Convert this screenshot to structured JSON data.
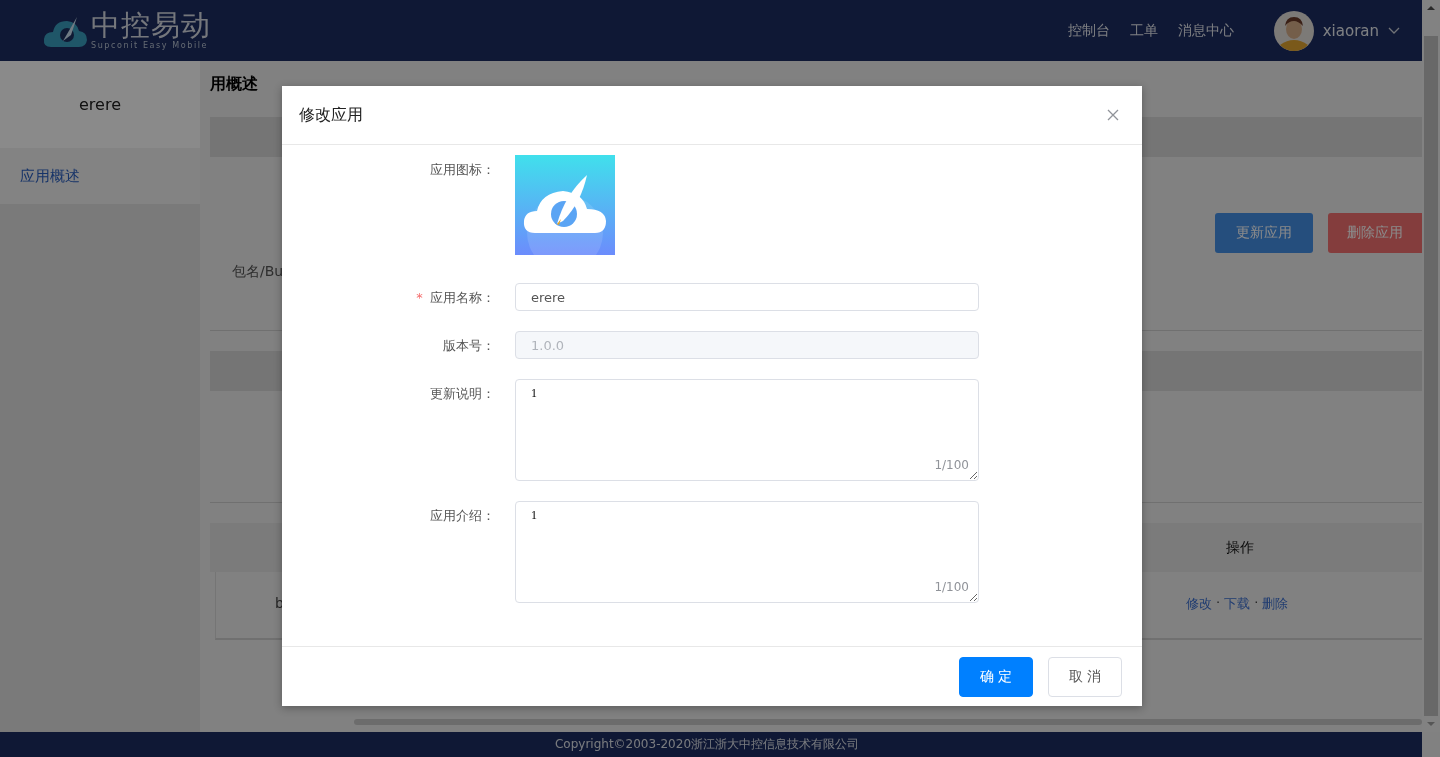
{
  "header": {
    "logo_title": "中控易动",
    "logo_subtitle": "Supconit Easy Mobile",
    "nav": [
      "控制台",
      "工单",
      "消息中心"
    ],
    "user": {
      "name": "xiaoran"
    }
  },
  "sidebar": {
    "app_name": "erere",
    "items": [
      {
        "label": "应用概述",
        "selected": true
      }
    ]
  },
  "main": {
    "heading": "用概述",
    "info_partial": "包名/Bu",
    "actions": [
      {
        "label": "更新应用",
        "kind": "primary"
      },
      {
        "label": "删除应用",
        "kind": "danger"
      }
    ],
    "table": {
      "action_header": "操作",
      "row_first_cell": "b",
      "row_actions": [
        "修改",
        "下载",
        "删除"
      ],
      "separator": "·"
    }
  },
  "modal": {
    "title": "修改应用",
    "required_mark": "*",
    "fields": [
      {
        "kind": "image",
        "label": "应用图标："
      },
      {
        "kind": "input",
        "label": "应用名称：",
        "required": true,
        "disabled": false,
        "value": "erere"
      },
      {
        "kind": "input",
        "label": "版本号：",
        "required": false,
        "disabled": true,
        "value": "1.0.0"
      },
      {
        "kind": "textarea",
        "label": "更新说明：",
        "value": "1",
        "counter": "1/100"
      },
      {
        "kind": "textarea",
        "label": "应用介绍：",
        "value": "1",
        "counter": "1/100"
      }
    ],
    "buttons": [
      {
        "label": "确 定",
        "kind": "primary"
      },
      {
        "label": "取 消",
        "kind": "default"
      }
    ]
  },
  "footer": {
    "copyright": "Copyright©2003-2020浙江浙大中控信息技术有限公司"
  }
}
